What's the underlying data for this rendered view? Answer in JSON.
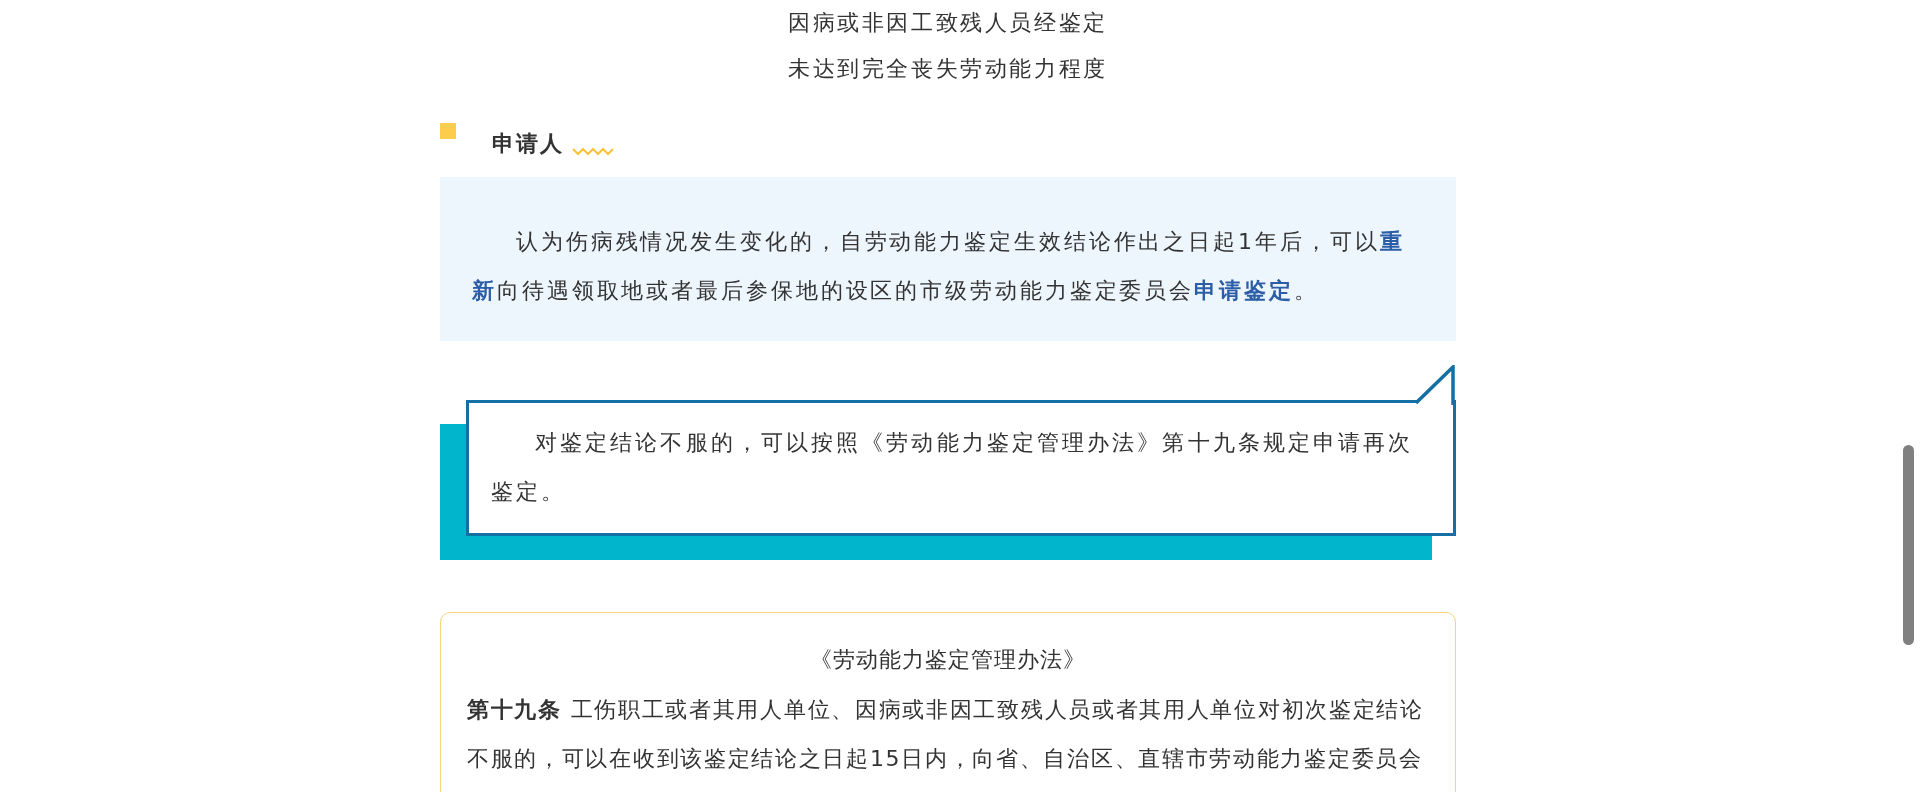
{
  "intro_lines": [
    "因病或非因工致残人员经鉴定",
    "未达到完全丧失劳动能力程度"
  ],
  "section": {
    "heading": "申请人"
  },
  "applicant_note": "认为伤病残情况发生变化的，自劳动能力鉴定生效结论作出之日起1年后，可以**重新**向待遇领取地或者最后参保地的设区的市级劳动能力鉴定委员会**申请鉴定**。",
  "callout": "对鉴定结论不服的，可以按照《劳动能力鉴定管理办法》第十九条规定申请再次鉴定。",
  "reference": {
    "title": "《劳动能力鉴定管理办法》",
    "text": "**第十九条** 工伤职工或者其用人单位、因病或非因工致残人员或者其用人单位对初次鉴定结论不服的，可以在收到该鉴定结论之日起15日内，向省、自治区、直辖市劳动能力鉴定委员会"
  }
}
